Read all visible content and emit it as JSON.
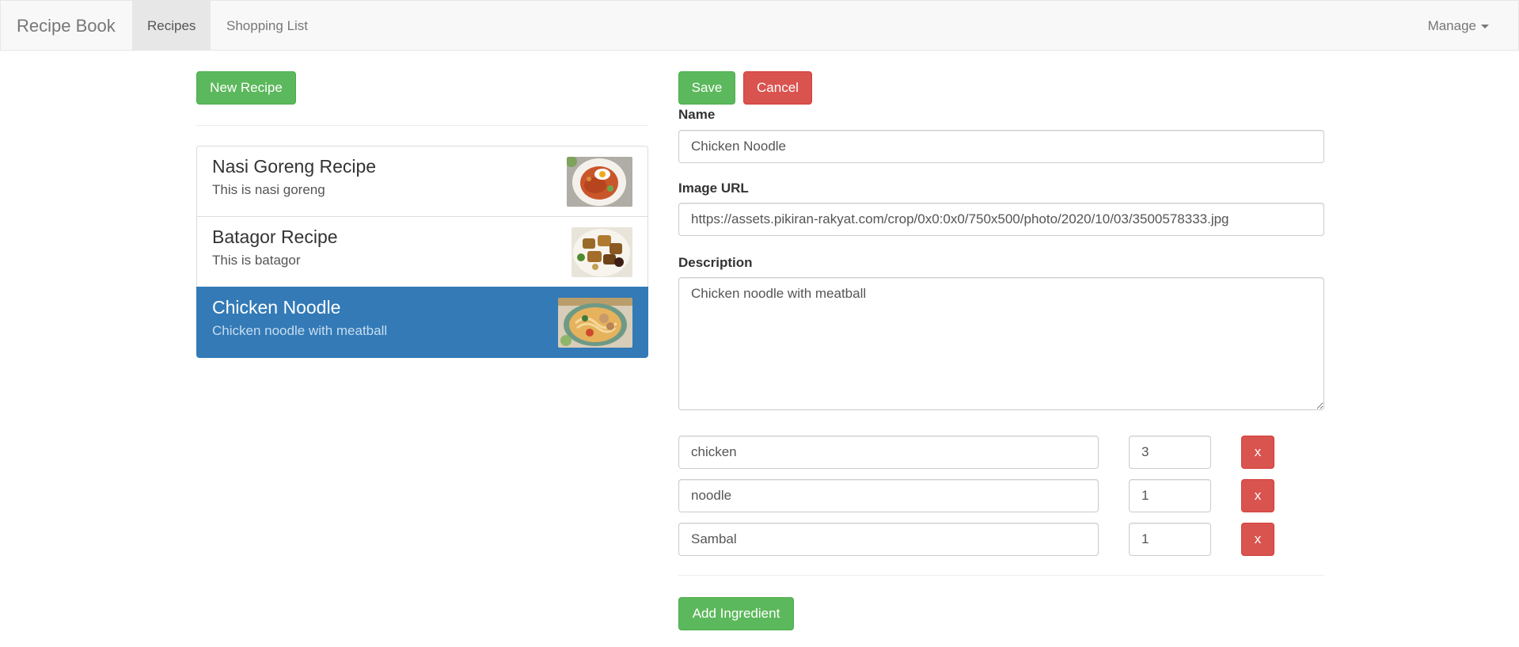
{
  "navbar": {
    "brand": "Recipe Book",
    "items": [
      {
        "label": "Recipes",
        "active": true
      },
      {
        "label": "Shopping List",
        "active": false
      }
    ],
    "manage_label": "Manage"
  },
  "left": {
    "new_recipe_label": "New Recipe",
    "recipes": [
      {
        "name": "Nasi Goreng Recipe",
        "description": "This is nasi goreng",
        "image_icon": "nasi-goreng-image"
      },
      {
        "name": "Batagor Recipe",
        "description": "This is batagor",
        "image_icon": "batagor-image"
      },
      {
        "name": "Chicken Noodle",
        "description": "Chicken noodle with meatball",
        "image_icon": "chicken-noodle-image",
        "active": true
      }
    ]
  },
  "form": {
    "save_label": "Save",
    "cancel_label": "Cancel",
    "name_label": "Name",
    "name_value": "Chicken Noodle",
    "image_url_label": "Image URL",
    "image_url_value": "https://assets.pikiran-rakyat.com/crop/0x0:0x0/750x500/photo/2020/10/03/3500578333.jpg",
    "description_label": "Description",
    "description_value": "Chicken noodle with meatball",
    "ingredients": [
      {
        "name": "chicken",
        "amount": "3",
        "remove_label": "x"
      },
      {
        "name": "noodle",
        "amount": "1",
        "remove_label": "x"
      },
      {
        "name": "Sambal",
        "amount": "1",
        "remove_label": "x"
      }
    ],
    "add_ingredient_label": "Add Ingredient"
  },
  "colors": {
    "success": "#5cb85c",
    "danger": "#d9534f",
    "active_item": "#337ab7"
  }
}
